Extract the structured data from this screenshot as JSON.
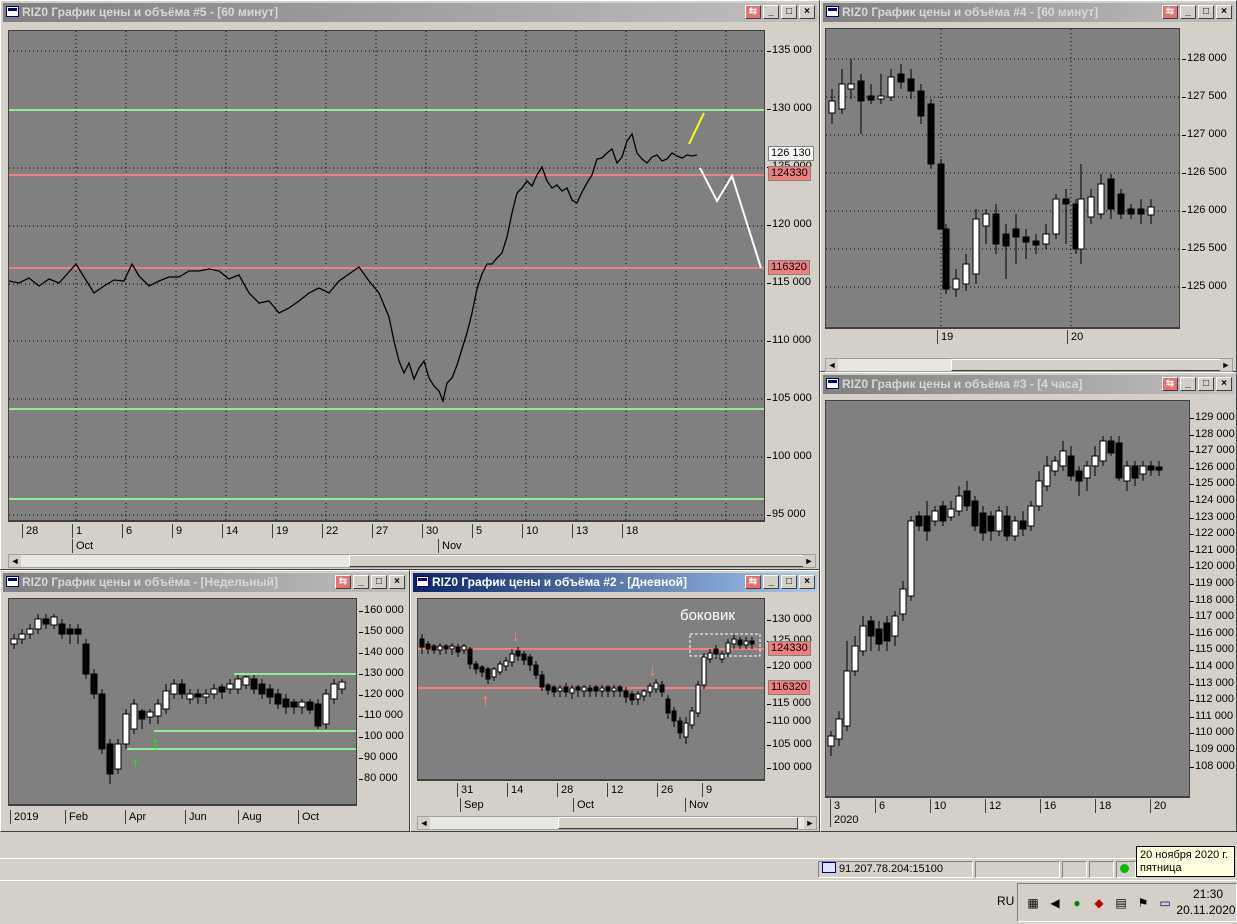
{
  "colors": {
    "plot_bg": "#808080",
    "bull": "#ffffff",
    "bear": "#000000",
    "support": "#90ee90",
    "resistance": "#f08080",
    "yellow_line": "#ffff00",
    "white_line": "#ffffff",
    "up_arrow_green": "#00ff00",
    "down_arrow_pink": "#f08080",
    "up_arrow_orange": "#ff8c42"
  },
  "title_buttons": {
    "link": "⇆",
    "minimize": "_",
    "maximize": "□",
    "close": "×"
  },
  "chart5": {
    "title": "RIZ0 График цены и объёма #5 - [60 минут]",
    "y_labels": [
      "135 000",
      "130 000",
      "125 000",
      "120 000",
      "115 000",
      "110 000",
      "105 000",
      "100 000",
      "95 000"
    ],
    "price_tags": {
      "last": "126 130",
      "level1": "124330",
      "level2": "116320"
    },
    "x_labels": [
      "28",
      "1",
      "6",
      "9",
      "14",
      "19",
      "22",
      "27",
      "30",
      "5",
      "10",
      "13",
      "18"
    ],
    "x_months": [
      "Oct",
      "Nov"
    ]
  },
  "chart4": {
    "title": "RIZ0 График цены и объёма #4 - [60 минут]",
    "y_labels": [
      "128 000",
      "127 500",
      "127 000",
      "126 500",
      "126 000",
      "125 500",
      "125 000"
    ],
    "x_labels": [
      "19",
      "20"
    ]
  },
  "chart3": {
    "title": "RIZ0 График цены и объёма #3 - [4 часа]",
    "y_labels": [
      "129 000",
      "128 000",
      "127 000",
      "126 000",
      "125 000",
      "124 000",
      "123 000",
      "122 000",
      "121 000",
      "120 000",
      "119 000",
      "118 000",
      "117 000",
      "116 000",
      "115 000",
      "114 000",
      "113 000",
      "112 000",
      "111 000",
      "110 000",
      "109 000",
      "108 000"
    ],
    "x_labels": [
      "3",
      "6",
      "10",
      "12",
      "16",
      "18",
      "20"
    ],
    "x_year": "2020"
  },
  "chart_weekly": {
    "title": "RIZ0 График цены и объёма - [Недельный]",
    "y_labels": [
      "160 000",
      "150 000",
      "140 000",
      "130 000",
      "120 000",
      "110 000",
      "100 000",
      "90 000",
      "80 000"
    ],
    "x_labels": [
      "2019",
      "Feb",
      "Apr",
      "Jun",
      "Aug",
      "Oct"
    ]
  },
  "chart2": {
    "title": "RIZ0 График цены и объёма #2 - [Дневной]",
    "annotation": "боковик",
    "y_labels": [
      "130 000",
      "125 000",
      "120 000",
      "115 000",
      "110 000",
      "105 000",
      "100 000"
    ],
    "price_tags": {
      "level1": "124330",
      "level2": "116320"
    },
    "x_labels": [
      "31",
      "14",
      "28",
      "12",
      "26",
      "9"
    ],
    "x_months": [
      "Sep",
      "Oct",
      "Nov"
    ]
  },
  "statusbar": {
    "connection": "91.207.78.204:15100"
  },
  "taskbar": {
    "lang": "RU",
    "time": "21:30",
    "date": "20.11.2020"
  },
  "tooltip": {
    "line1": "20 ноября 2020 г.",
    "line2": "пятница"
  }
}
